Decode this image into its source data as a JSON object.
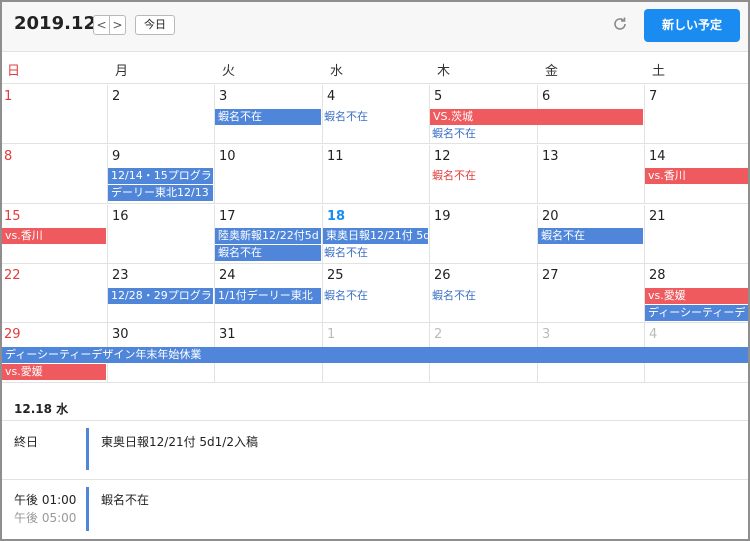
{
  "header": {
    "month": "2019.12",
    "prev": "<",
    "next": ">",
    "today": "今日",
    "refresh_icon": "refresh-icon",
    "new_event": "新しい予定"
  },
  "weekdays": [
    "日",
    "月",
    "火",
    "水",
    "木",
    "金",
    "土"
  ],
  "weeks": [
    {
      "days": [
        "1",
        "2",
        "3",
        "4",
        "5",
        "6",
        "7"
      ]
    },
    {
      "days": [
        "8",
        "9",
        "10",
        "11",
        "12",
        "13",
        "14"
      ]
    },
    {
      "days": [
        "15",
        "16",
        "17",
        "18",
        "19",
        "20",
        "21"
      ]
    },
    {
      "days": [
        "22",
        "23",
        "24",
        "25",
        "26",
        "27",
        "28"
      ]
    },
    {
      "days": [
        "29",
        "30",
        "31",
        "1",
        "2",
        "3",
        "4"
      ]
    }
  ],
  "events": {
    "w1_tue": "蝦名不在",
    "w1_wed": "蝦名不在",
    "w1_thu_bar": "VS.茨城",
    "w1_thu_txt": "蝦名不在",
    "w2_mon_1": "12/14・15プログラ",
    "w2_mon_2": "デーリー東北12/13",
    "w2_thu": "蝦名不在",
    "w2_sat": "vs.香川",
    "w3_sun": "vs.香川",
    "w3_tue_1": "陸奥新報12/22付5d",
    "w3_tue_2": "蝦名不在",
    "w3_wed_1": "東奥日報12/21付 5d",
    "w3_wed_2": "蝦名不在",
    "w3_fri": "蝦名不在",
    "w4_mon": "12/28・29プログラ",
    "w4_tue": "1/1付デーリー東北",
    "w4_wed": "蝦名不在",
    "w4_thu": "蝦名不在",
    "w4_sat_1": "vs.愛媛",
    "w4_sat_2": "ディーシーティーデ",
    "w5_span": "ディーシーティーデザイン年末年始休業",
    "w5_sun": "vs.愛媛"
  },
  "detail": {
    "date": "12.18 水",
    "items": [
      {
        "time": "終日",
        "time2": "",
        "title": "東奥日報12/21付 5d1/2入稿"
      },
      {
        "time": "午後 01:00",
        "time2": "午後 05:00",
        "title": "蝦名不在"
      }
    ]
  },
  "colors": {
    "accent": "#1a8bf1",
    "event_blue": "#4f86d9",
    "event_red": "#ee5a5e",
    "sunday": "#e13c3c"
  }
}
